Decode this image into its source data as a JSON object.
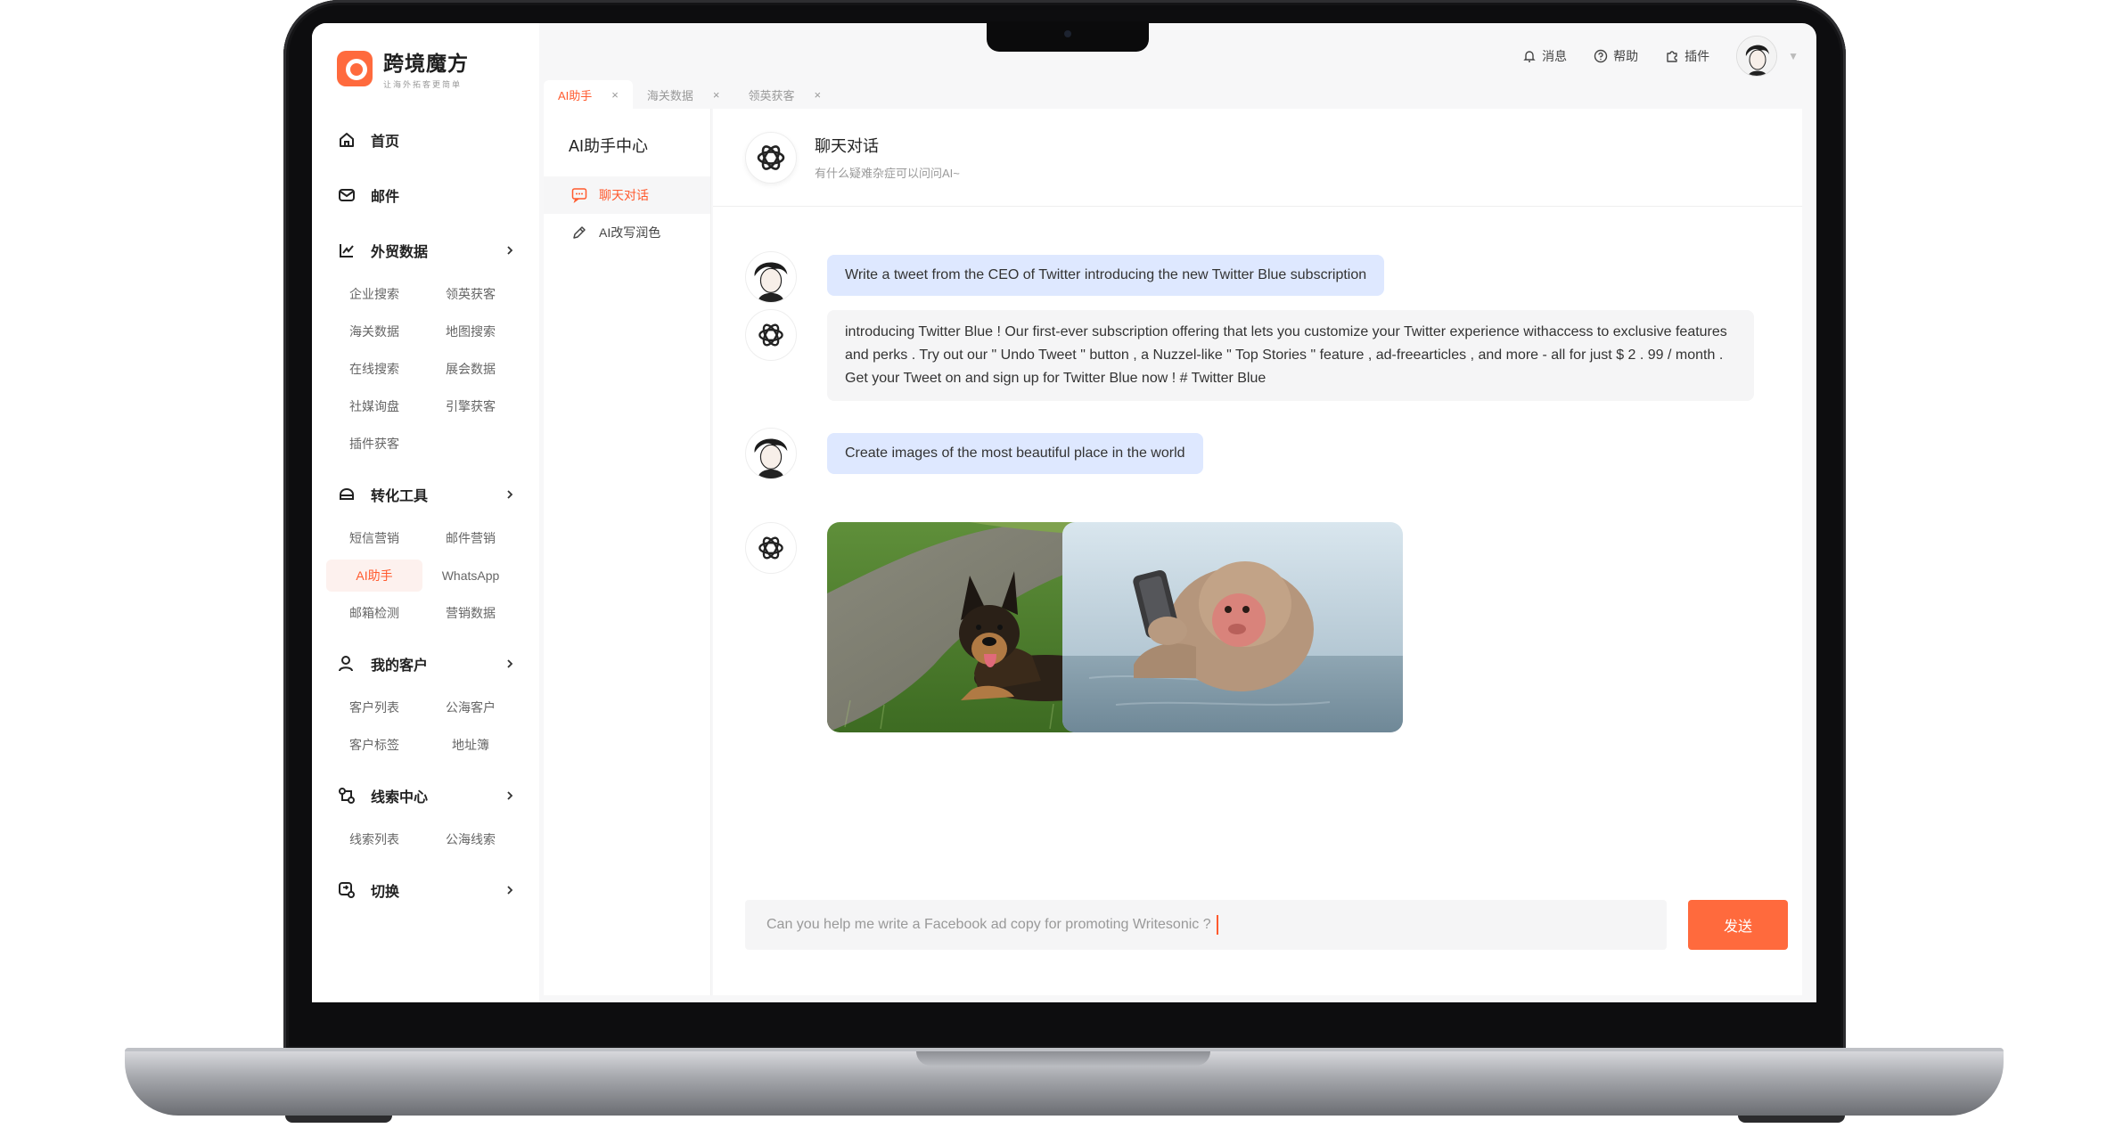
{
  "app": {
    "logo_title": "跨境魔方",
    "logo_subtitle": "让海外拓客更简单"
  },
  "topbar": {
    "messages": "消息",
    "help": "帮助",
    "plugins": "插件"
  },
  "tabs": [
    {
      "label": "AI助手",
      "active": true
    },
    {
      "label": "海关数据",
      "active": false
    },
    {
      "label": "领英获客",
      "active": false
    }
  ],
  "sidebar": {
    "home": "首页",
    "mail": "邮件",
    "trade_data": {
      "label": "外贸数据",
      "items": [
        "企业搜索",
        "领英获客",
        "海关数据",
        "地图搜索",
        "在线搜索",
        "展会数据",
        "社媒询盘",
        "引擎获客",
        "插件获客"
      ]
    },
    "conversion": {
      "label": "转化工具",
      "items": [
        "短信营销",
        "邮件营销",
        "AI助手",
        "WhatsApp",
        "邮箱检测",
        "营销数据"
      ]
    },
    "customers": {
      "label": "我的客户",
      "items": [
        "客户列表",
        "公海客户",
        "客户标签",
        "地址簿"
      ]
    },
    "leads": {
      "label": "线索中心",
      "items": [
        "线索列表",
        "公海线索"
      ]
    },
    "switch": "切换"
  },
  "assistant_panel": {
    "title": "AI助手中心",
    "items": [
      {
        "label": "聊天对话",
        "active": true
      },
      {
        "label": "AI改写润色",
        "active": false
      }
    ]
  },
  "chat": {
    "title": "聊天对话",
    "subtitle": "有什么疑难杂症可以问问AI~",
    "messages": [
      {
        "role": "user",
        "text": "Write a tweet from the CEO of Twitter introducing the new Twitter Blue subscription"
      },
      {
        "role": "ai",
        "text": "introducing Twitter Blue ! Our first-ever subscription offering that lets you customize your Twitter experience withaccess to exclusive features and perks . Try out our \" Undo Tweet \" button , a Nuzzel-like \" Top Stories \" feature , ad-freearticles , and more - all for just $ 2 . 99 / month . Get your Tweet on and sign up for Twitter Blue now ! # Twitter Blue"
      },
      {
        "role": "user",
        "text": "Create images of the most beautiful place in the world"
      },
      {
        "role": "ai",
        "images": [
          "dog-on-grass-photo",
          "monkey-with-phone-in-hot-spring-photo"
        ]
      }
    ],
    "input_value": "Can you help me write a Facebook ad copy for promoting Writesonic ?",
    "send_label": "发送"
  },
  "colors": {
    "accent": "#ff6a3d",
    "user_bubble": "#dee8ff",
    "ai_bubble": "#f5f5f6"
  }
}
